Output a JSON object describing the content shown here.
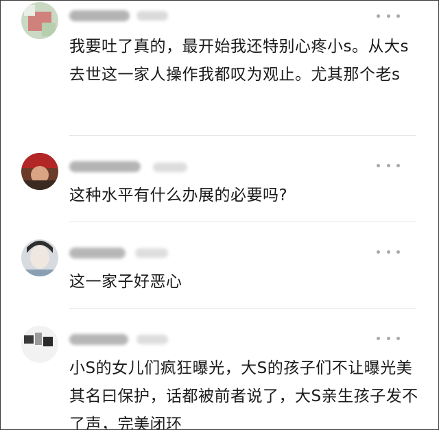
{
  "comments": [
    {
      "text": "我要吐了真的，最开始我还特别心疼小s。从大s去世这一家人操作我都叹为观止。尤其那个老s"
    },
    {
      "text": "这种水平有什么办展的必要吗?"
    },
    {
      "text": "这一家子好恶心"
    },
    {
      "text": "小S的女儿们疯狂曝光，大S的孩子们不让曝光美其名曰保护，话都被前者说了，大S亲生孩子发不了声，完美闭环"
    }
  ],
  "icons": {
    "more": "more-options-icon",
    "avatar": "user-avatar"
  },
  "colors": {
    "text": "#1a1a1a",
    "more_dots": "#a9a9a9",
    "divider": "#e6e6e6",
    "frame_border": "#3a3a3a"
  }
}
